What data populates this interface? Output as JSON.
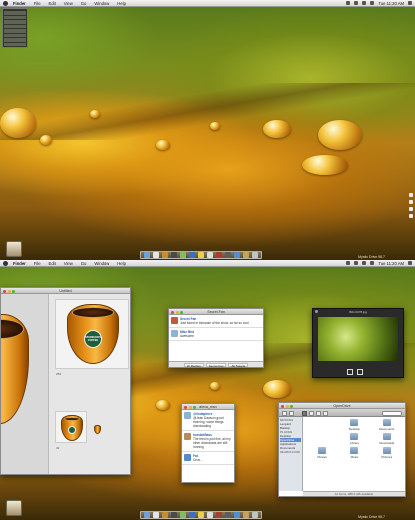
{
  "menubar": {
    "app": "Finder",
    "items": [
      "File",
      "Edit",
      "View",
      "Go",
      "Window",
      "Help"
    ],
    "clock_top": "Tue 11:20 AM",
    "clock_bottom": "Tue 11:20 AM"
  },
  "desktop": {
    "statustext_top": "Mystic Drive 98.7",
    "statustext_bottom": "Mystic Drive 98.7"
  },
  "sidewidget": {
    "rows": [
      "",
      "",
      "",
      "",
      "",
      "",
      "",
      ""
    ]
  },
  "icon_window": {
    "title": "Untitled",
    "label_small": "256",
    "label_tiny": "32",
    "logo_text": "STARBUCKS COFFEE"
  },
  "tweet_window": {
    "title": "Secret Fan",
    "rows": [
      {
        "name": "Secret Fan",
        "text": "Just tuned in because of the show, so far so cool"
      },
      {
        "name": "Mike Bist",
        "text": "Awesome"
      }
    ],
    "footer": [
      "@ Replies",
      "Secret Fan",
      "All Tweets"
    ]
  },
  "photo_window": {
    "title": "IMG 0078.jpg"
  },
  "chat_window": {
    "title": "alexa_msn",
    "rows": [
      {
        "name": "@lindapierre",
        "text": "@Jean Dawson good morning, some things downloading"
      },
      {
        "name": "humbleBass",
        "text": "The feed is just fine, all my other downloads are still running"
      },
      {
        "name": "Fat",
        "text": "Chat ..."
      }
    ]
  },
  "finder_window": {
    "title": "OpenDrive",
    "sidebar": [
      {
        "label": "DEVICES",
        "header": true
      },
      {
        "label": "Leopard"
      },
      {
        "label": "Backup"
      },
      {
        "label": "PLACES",
        "header": true
      },
      {
        "label": "Desktop"
      },
      {
        "label": "OpenDrive",
        "selected": true
      },
      {
        "label": "Applications"
      },
      {
        "label": "Documents"
      },
      {
        "label": "SEARCH FOR",
        "header": true
      }
    ],
    "items": [
      "Desktop",
      "Documents",
      "Library",
      "Downloads",
      "Movies",
      "Music",
      "Pictures"
    ],
    "status": "12 items, 288.4 GB available"
  }
}
